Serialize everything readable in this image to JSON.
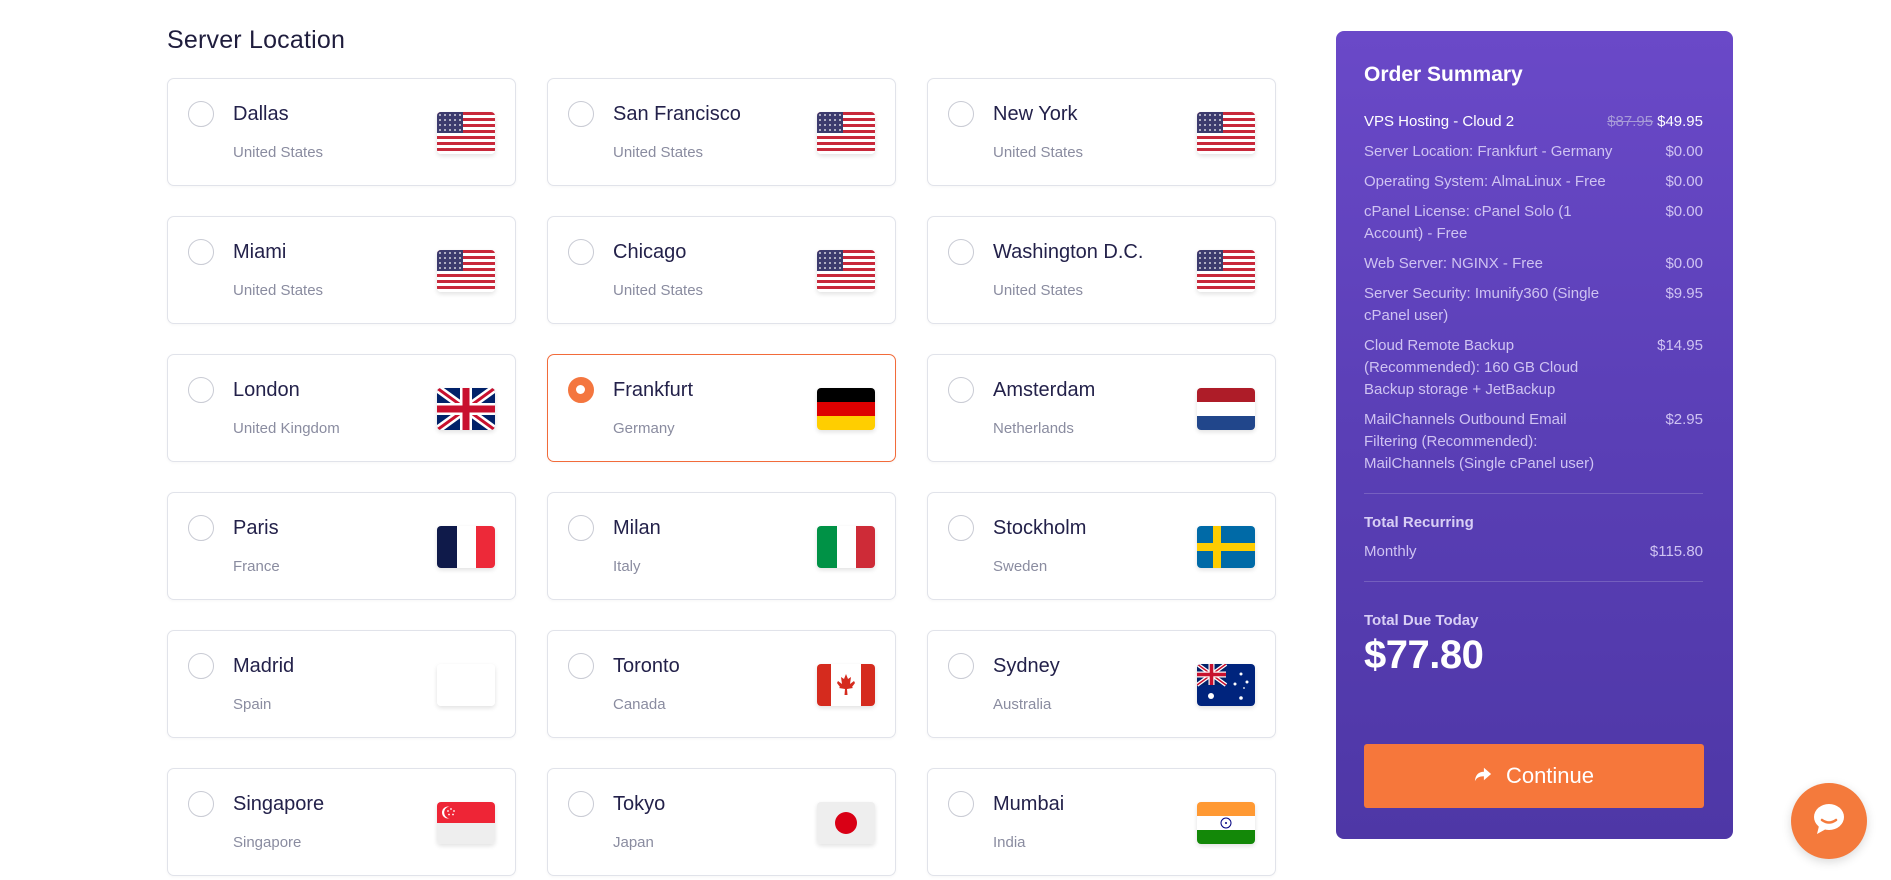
{
  "section": {
    "title": "Server Location"
  },
  "locations": [
    {
      "city": "Dallas",
      "country": "United States",
      "flag": "us-flag",
      "selected": false
    },
    {
      "city": "San Francisco",
      "country": "United States",
      "flag": "us-flag",
      "selected": false
    },
    {
      "city": "New York",
      "country": "United States",
      "flag": "us-flag",
      "selected": false
    },
    {
      "city": "Miami",
      "country": "United States",
      "flag": "us-flag",
      "selected": false
    },
    {
      "city": "Chicago",
      "country": "United States",
      "flag": "us-flag",
      "selected": false
    },
    {
      "city": "Washington D.C.",
      "country": "United States",
      "flag": "us-flag",
      "selected": false
    },
    {
      "city": "London",
      "country": "United Kingdom",
      "flag": "uk-flag",
      "selected": false
    },
    {
      "city": "Frankfurt",
      "country": "Germany",
      "flag": "germany-flag",
      "selected": true
    },
    {
      "city": "Amsterdam",
      "country": "Netherlands",
      "flag": "netherlands-flag",
      "selected": false
    },
    {
      "city": "Paris",
      "country": "France",
      "flag": "france-flag",
      "selected": false
    },
    {
      "city": "Milan",
      "country": "Italy",
      "flag": "italy-flag",
      "selected": false
    },
    {
      "city": "Stockholm",
      "country": "Sweden",
      "flag": "sweden-flag",
      "selected": false
    },
    {
      "city": "Madrid",
      "country": "Spain",
      "flag": "spain-flag",
      "selected": false
    },
    {
      "city": "Toronto",
      "country": "Canada",
      "flag": "canada-flag",
      "selected": false
    },
    {
      "city": "Sydney",
      "country": "Australia",
      "flag": "australia-flag",
      "selected": false
    },
    {
      "city": "Singapore",
      "country": "Singapore",
      "flag": "singapore-flag",
      "selected": false
    },
    {
      "city": "Tokyo",
      "country": "Japan",
      "flag": "japan-flag",
      "selected": false
    },
    {
      "city": "Mumbai",
      "country": "India",
      "flag": "india-flag",
      "selected": false
    }
  ],
  "summary": {
    "title": "Order Summary",
    "product": {
      "label": "VPS Hosting - Cloud 2",
      "old_price": "$87.95",
      "price": "$49.95"
    },
    "items": [
      {
        "label": "Server Location: Frankfurt - Germany",
        "amount": "$0.00"
      },
      {
        "label": "Operating System: AlmaLinux - Free",
        "amount": "$0.00"
      },
      {
        "label": "cPanel License: cPanel Solo (1 Account) - Free",
        "amount": "$0.00"
      },
      {
        "label": "Web Server: NGINX - Free",
        "amount": "$0.00"
      },
      {
        "label": "Server Security: Imunify360 (Single cPanel user)",
        "amount": "$9.95"
      },
      {
        "label": "Cloud Remote Backup (Recommended): 160 GB Cloud Backup storage + JetBackup",
        "amount": "$14.95"
      },
      {
        "label": "MailChannels Outbound Email Filtering (Recommended): MailChannels (Single cPanel user)",
        "amount": "$2.95"
      }
    ],
    "recurring_title": "Total Recurring",
    "recurring_period": "Monthly",
    "recurring_amount": "$115.80",
    "due_label": "Total Due Today",
    "due_amount": "$77.80",
    "continue_label": "Continue",
    "continue_icon": "arrow-forward-icon"
  },
  "chat": {
    "icon": "chat-bubble-icon"
  },
  "colors": {
    "accent": "#f6773b",
    "summary_bg": "#5a3fb6",
    "text_dark": "#1f1d3d",
    "text_muted": "#8a8ca0",
    "card_border": "#e1e3ea"
  }
}
